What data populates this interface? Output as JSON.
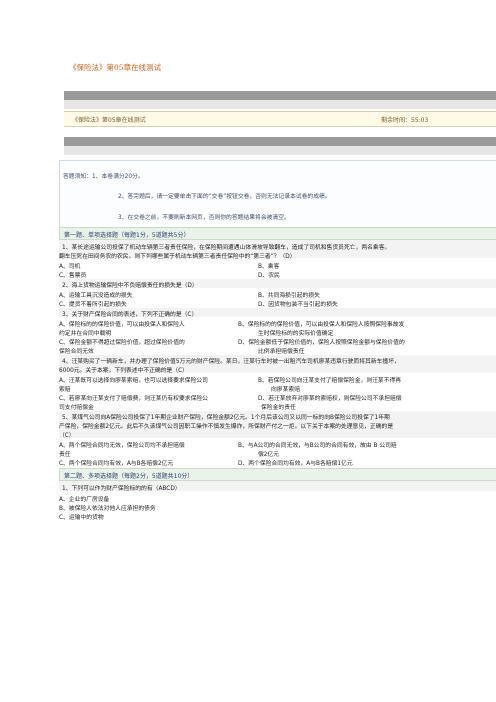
{
  "doc_title": "《保险法》第05章在线测试",
  "infobar": {
    "title": "《保险法》第05章在线测试",
    "remaining": "剩余时间：55:03"
  },
  "notice": {
    "l1": "答题须知：1、本卷满分20分。",
    "l2": "2、答完题后，请一定要单击下面的“交卷”按钮交卷，否则无法记录本试卷的成绩。",
    "l3": "3、在交卷之前，不要刷新本网页，否则你的答题结果将会被清空。"
  },
  "section1": {
    "title": "第一题、单项选择题（每题1分，5道题共5分）"
  },
  "q1": {
    "stem1": "1、某长途运输公司投保了机动车辆第三者责任保险，在保险期间遭遇山体滑坡导致翻车，造成了司机和售货员死亡，两名乘客。",
    "stem2": "翻车压死在田间务农的农民。则下列哪些属于机动车辆第三者责任保险中的“第三者”？（D）",
    "a": "A、司机",
    "b": "B、乘客",
    "c": "C、售票员",
    "d": "D、农民"
  },
  "q2": {
    "stem": "2、海上货物运输保险中不负赔偿责任的损失是（D）",
    "a": "A、运输工具沉没造成的损失",
    "b": "B、共同海损引起的损失",
    "c": "C、提货不着所引起的损失",
    "d": "D、因货物包装不当引起的损失"
  },
  "q3": {
    "stem": "3、关于财产保险合同的表述，下列不正确的是（C）",
    "a1": "A、保险标的的保险价值，可以由投保人和保险人",
    "b1": "B、保险标的的保险价值，可以由投保人和保险人按照保险事故发",
    "a2": "约定并在合同中载明",
    "b2": "生时保险标的的实际价值确定",
    "c1": "C、保险金额不得超过保险价值，超过保险价值的",
    "d1": "D、保险金额低于保险价值的，保险人按照保险金额与保险价值的",
    "c2": "保险合同无效",
    "d2": "比例承担赔偿责任"
  },
  "q4": {
    "stem1": "4、汪某购买了一辆新车，并办理了保险价值5万元的财产保险。某日，汪某行车时被一出租汽车司机廖某违章行驶而将其新车撞坏，",
    "stem2": "6000元。关于本案，下列表述中不正确的是（C）",
    "a1": "A、汪某既可以选择向廖某索赔，也可以选择要求保险公司",
    "b1": "B、若保险公司向汪某支付了赔偿保险金，则汪某不得再",
    "a2": "索赔",
    "b2": "向廖某索赔",
    "c1": "C、若廖某向汪某支付了赔偿费，则汪某仍有权要求保险公",
    "d1": "D、若汪某放弃对廖某的索赔权，则保险公司不承担赔偿",
    "c2": "司支付赔偿金",
    "d2": "保险金的责任"
  },
  "q5": {
    "stem1": "5、某煤气公司向A保险公司投保了1年期企业财产保险，保险金额2亿元。1个月后该公司又以同一标的向B保险公司投保了1年期",
    "stem2": "产保险，保险金额2亿元。此后不久该煤气公司因职工操作不慎发生爆炸，所保财产付之一炬。以下关于本案的处理意见，正确的是",
    "stem3": "（C）",
    "a1": "A、两个保险合同均无效，保险公司均不承担赔偿",
    "b1": "B、与A公司的合同无效，与B公司的合同有效，故由 B 公司赔",
    "a2": "责任",
    "b2": "偿2亿元",
    "c": "C、两个保险合同均有效，A与B各赔偿2亿元",
    "d": "D、两个保险合同均有效，A与B各赔偿1亿元"
  },
  "section2": {
    "title": "第二题、多项选择题（每题2分，5道题共10分）"
  },
  "m1": {
    "stem": "1、下列可以作为财产保险标的的有（ABCD）",
    "a": "A、企业的厂房设备",
    "b": "B、被保险人依法对他人应承担的债务",
    "c": "C、运输中的货物"
  }
}
